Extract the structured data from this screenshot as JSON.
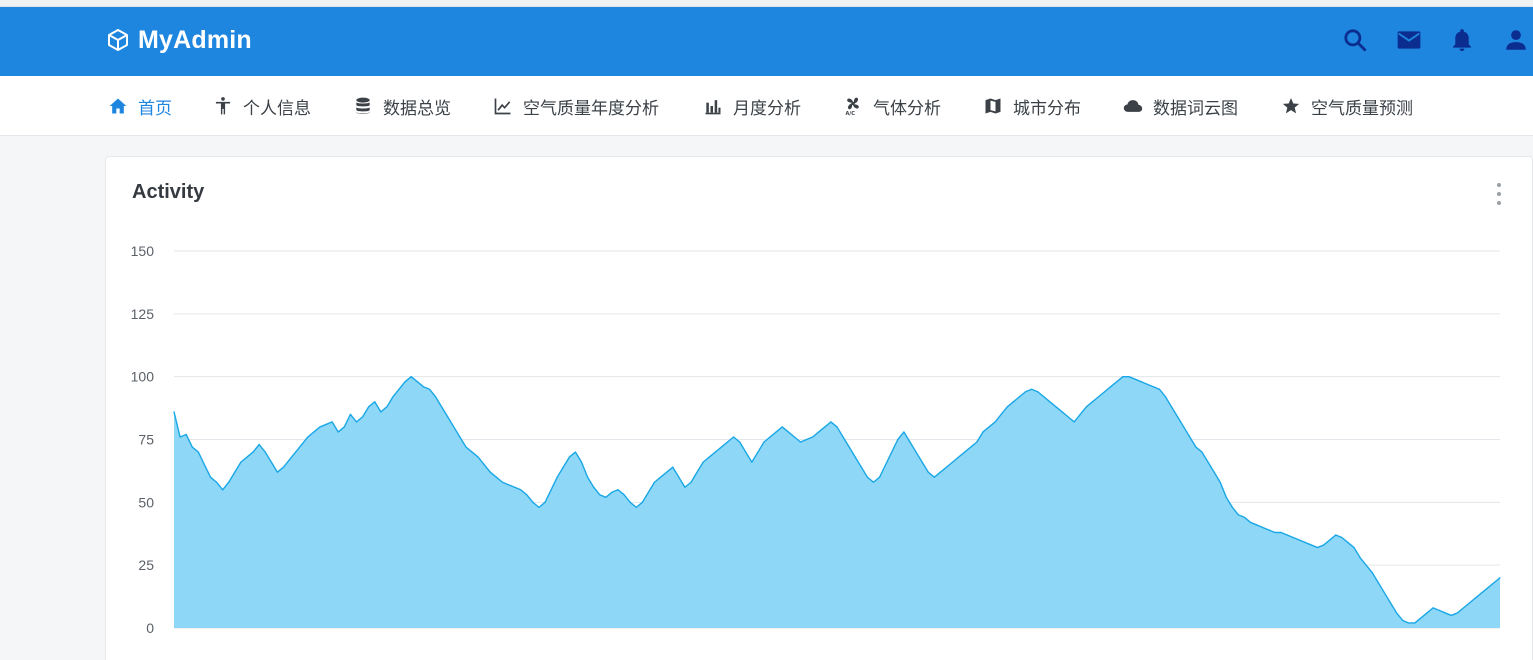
{
  "app": {
    "brand": "MyAdmin"
  },
  "topbar": {
    "icons": [
      "search-icon",
      "mail-icon",
      "bell-icon",
      "user-icon"
    ]
  },
  "nav": {
    "items": [
      {
        "label": "首页",
        "icon": "home-icon",
        "active": true
      },
      {
        "label": "个人信息",
        "icon": "accessibility-icon",
        "active": false
      },
      {
        "label": "数据总览",
        "icon": "database-icon",
        "active": false
      },
      {
        "label": "空气质量年度分析",
        "icon": "line-chart-icon",
        "active": false
      },
      {
        "label": "月度分析",
        "icon": "bar-chart-icon",
        "active": false
      },
      {
        "label": "气体分析",
        "icon": "fan-icon",
        "active": false
      },
      {
        "label": "城市分布",
        "icon": "map-icon",
        "active": false
      },
      {
        "label": "数据词云图",
        "icon": "cloud-icon",
        "active": false
      },
      {
        "label": "空气质量预测",
        "icon": "star-icon",
        "active": false
      }
    ]
  },
  "card": {
    "title": "Activity"
  },
  "colors": {
    "primary": "#1f86e0",
    "area_fill": "#8fd7f6",
    "area_line": "#19a7e6"
  },
  "chart_data": {
    "type": "area",
    "title": "Activity",
    "xlabel": "",
    "ylabel": "",
    "ylim": [
      0,
      150
    ],
    "yticks": [
      0,
      25,
      50,
      75,
      100,
      125,
      150
    ],
    "grid": true,
    "series": [
      {
        "values": [
          86,
          76,
          77,
          72,
          70,
          65,
          60,
          58,
          55,
          58,
          62,
          66,
          68,
          70,
          73,
          70,
          66,
          62,
          64,
          67,
          70,
          73,
          76,
          78,
          80,
          81,
          82,
          78,
          80,
          85,
          82,
          84,
          88,
          90,
          86,
          88,
          92,
          95,
          98,
          100,
          98,
          96,
          95,
          92,
          88,
          84,
          80,
          76,
          72,
          70,
          68,
          65,
          62,
          60,
          58,
          57,
          56,
          55,
          53,
          50,
          48,
          50,
          55,
          60,
          64,
          68,
          70,
          66,
          60,
          56,
          53,
          52,
          54,
          55,
          53,
          50,
          48,
          50,
          54,
          58,
          60,
          62,
          64,
          60,
          56,
          58,
          62,
          66,
          68,
          70,
          72,
          74,
          76,
          74,
          70,
          66,
          70,
          74,
          76,
          78,
          80,
          78,
          76,
          74,
          75,
          76,
          78,
          80,
          82,
          80,
          76,
          72,
          68,
          64,
          60,
          58,
          60,
          65,
          70,
          75,
          78,
          74,
          70,
          66,
          62,
          60,
          62,
          64,
          66,
          68,
          70,
          72,
          74,
          78,
          80,
          82,
          85,
          88,
          90,
          92,
          94,
          95,
          94,
          92,
          90,
          88,
          86,
          84,
          82,
          85,
          88,
          90,
          92,
          94,
          96,
          98,
          100,
          100,
          99,
          98,
          97,
          96,
          95,
          92,
          88,
          84,
          80,
          76,
          72,
          70,
          66,
          62,
          58,
          52,
          48,
          45,
          44,
          42,
          41,
          40,
          39,
          38,
          38,
          37,
          36,
          35,
          34,
          33,
          32,
          33,
          35,
          37,
          36,
          34,
          32,
          28,
          25,
          22,
          18,
          14,
          10,
          6,
          3,
          2,
          2,
          4,
          6,
          8,
          7,
          6,
          5,
          6,
          8,
          10,
          12,
          14,
          16,
          18,
          20
        ]
      }
    ]
  }
}
